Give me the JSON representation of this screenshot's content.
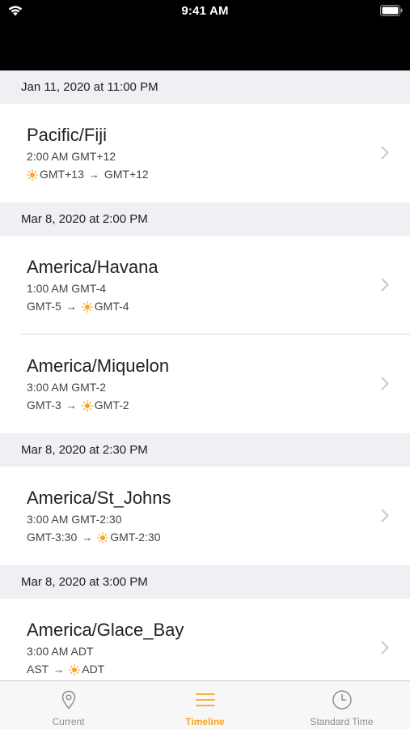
{
  "status_bar": {
    "time": "9:41 AM"
  },
  "sections": [
    {
      "date": "Jan 11, 2020 at 11:00 PM",
      "items": [
        {
          "zone": "Pacific/Fiji",
          "time": "2:00 AM GMT+12",
          "from": "GMT+13",
          "from_dst": true,
          "to": "GMT+12",
          "to_dst": false
        }
      ]
    },
    {
      "date": "Mar 8, 2020 at 2:00 PM",
      "items": [
        {
          "zone": "America/Havana",
          "time": "1:00 AM GMT-4",
          "from": "GMT-5",
          "from_dst": false,
          "to": "GMT-4",
          "to_dst": true
        },
        {
          "zone": "America/Miquelon",
          "time": "3:00 AM GMT-2",
          "from": "GMT-3",
          "from_dst": false,
          "to": "GMT-2",
          "to_dst": true
        }
      ]
    },
    {
      "date": "Mar 8, 2020 at 2:30 PM",
      "items": [
        {
          "zone": "America/St_Johns",
          "time": "3:00 AM GMT-2:30",
          "from": "GMT-3:30",
          "from_dst": false,
          "to": "GMT-2:30",
          "to_dst": true
        }
      ]
    },
    {
      "date": "Mar 8, 2020 at 3:00 PM",
      "items": [
        {
          "zone": "America/Glace_Bay",
          "time": "3:00 AM ADT",
          "from": "AST",
          "from_dst": false,
          "to": "ADT",
          "to_dst": true
        }
      ]
    }
  ],
  "tab_bar": {
    "tabs": [
      {
        "label": "Current",
        "icon": "location-pin-icon",
        "active": false
      },
      {
        "label": "Timeline",
        "icon": "list-icon",
        "active": true
      },
      {
        "label": "Standard Time",
        "icon": "clock-icon",
        "active": false
      }
    ]
  },
  "colors": {
    "accent": "#f5a623",
    "inactive": "#8e8e93",
    "header_bg": "#efeff4"
  }
}
